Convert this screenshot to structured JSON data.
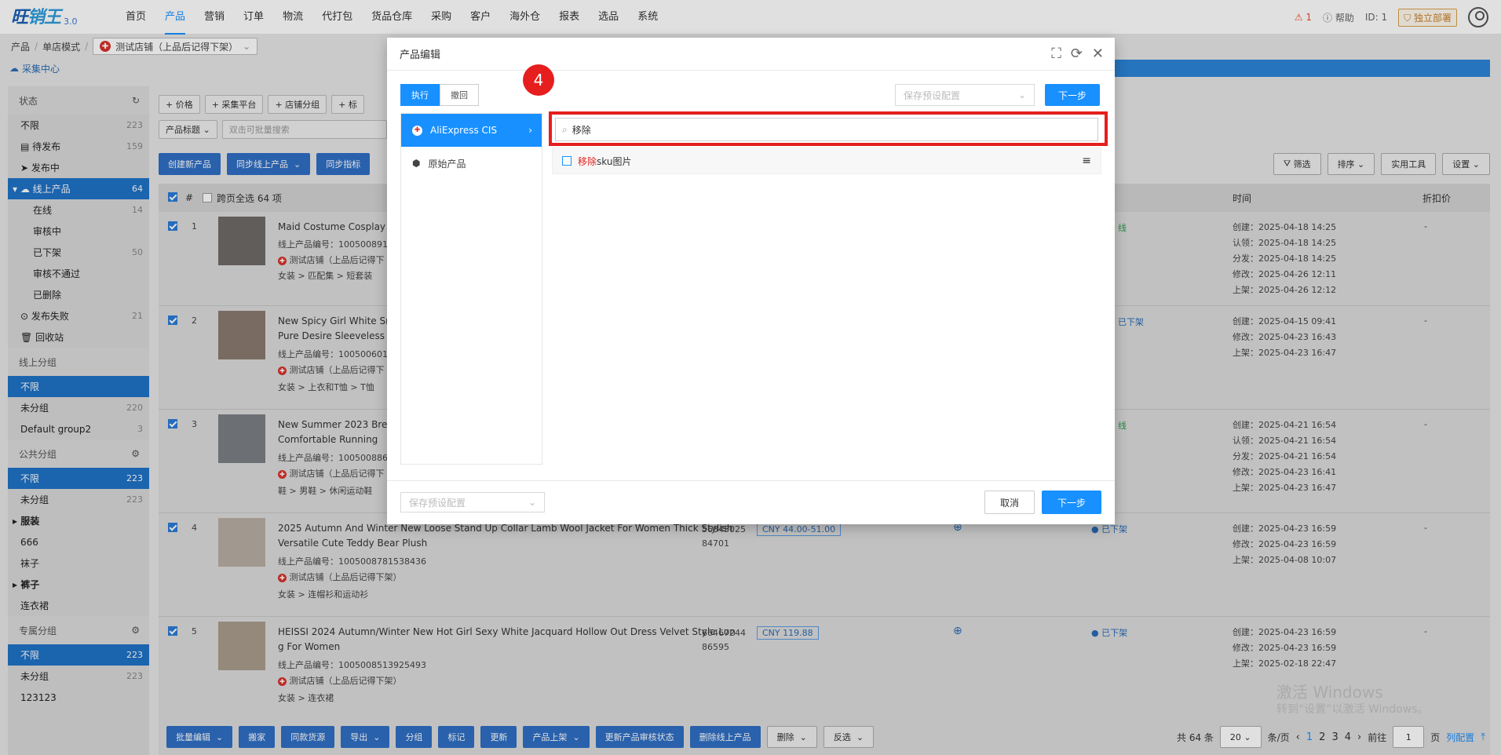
{
  "logo": {
    "text": "旺",
    "text2": "销王",
    "version": "3.0"
  },
  "nav": [
    "首页",
    "产品",
    "营销",
    "订单",
    "物流",
    "代打包",
    "货品仓库",
    "采购",
    "客户",
    "海外仓",
    "报表",
    "选品",
    "系统"
  ],
  "topright": {
    "alert": "⚠ 1",
    "help": "帮助",
    "id": "ID: 1",
    "deploy": "独立部署"
  },
  "breadcrumb": {
    "a": "产品",
    "b": "单店模式",
    "shop": "测试店铺（上品后记得下架）"
  },
  "cloud": "采集中心",
  "sidebar": {
    "status_head": "状态",
    "status": [
      {
        "l": "不限",
        "c": "223"
      },
      {
        "l": "待发布",
        "c": "159"
      },
      {
        "l": "发布中",
        "c": ""
      },
      {
        "l": "线上产品",
        "c": "64"
      },
      {
        "l": "在线",
        "c": "14"
      },
      {
        "l": "审核中",
        "c": ""
      },
      {
        "l": "已下架",
        "c": "50"
      },
      {
        "l": "审核不通过",
        "c": ""
      },
      {
        "l": "已删除",
        "c": ""
      },
      {
        "l": "发布失败",
        "c": "21"
      },
      {
        "l": "回收站",
        "c": ""
      }
    ],
    "online_head": "线上分组",
    "online": [
      {
        "l": "不限",
        "c": ""
      },
      {
        "l": "未分组",
        "c": "220"
      },
      {
        "l": "Default group2",
        "c": "3"
      }
    ],
    "public_head": "公共分组",
    "public": [
      {
        "l": "不限",
        "c": "223"
      },
      {
        "l": "未分组",
        "c": "223"
      },
      {
        "l": "服装",
        "c": ""
      },
      {
        "l": "666",
        "c": ""
      },
      {
        "l": "袜子",
        "c": ""
      },
      {
        "l": "裤子",
        "c": ""
      },
      {
        "l": "连衣裙",
        "c": ""
      }
    ],
    "exclusive_head": "专属分组",
    "exclusive": [
      {
        "l": "不限",
        "c": "223"
      },
      {
        "l": "未分组",
        "c": "223"
      },
      {
        "l": "123123",
        "c": ""
      }
    ]
  },
  "filters": [
    "+ 价格",
    "+ 采集平台",
    "+ 店铺分组",
    "+ 标"
  ],
  "search_field": {
    "sel": "产品标题",
    "ph": "双击可批量搜索"
  },
  "actions": [
    "创建新产品",
    "同步线上产品",
    "同步指标"
  ],
  "tools": [
    "筛选",
    "排序",
    "实用工具",
    "设置"
  ],
  "thead": {
    "num": "#",
    "all": "跨页全选 64 项",
    "time": "时间",
    "discount": "折扣价"
  },
  "rows": [
    {
      "n": "1",
      "title": "Maid Costume Cosplay Ap",
      "title2": "",
      "code": "线上产品编号：10050089112",
      "shop": "测试店铺（上品后记得下",
      "cat": "女装 > 匹配集 > 短套装",
      "status": "线",
      "times": [
        "创建：2025-04-18 14:25",
        "认领：2025-04-18 14:25",
        "分发：2025-04-18 14:25",
        "修改：2025-04-26 12:11",
        "上架：2025-04-26 12:12"
      ],
      "disc": "-"
    },
    {
      "n": "2",
      "title": "New Spicy Girl White Smal",
      "title2": "Pure Desire Sleeveless Bo",
      "code": "线上产品编号：10050060191",
      "shop": "测试店铺（上品后记得下",
      "cat": "女装 > 上衣和T恤 > T恤",
      "status": "已下架",
      "times": [
        "创建：2025-04-15 09:41",
        "修改：2025-04-23 16:43",
        "上架：2025-04-23 16:47"
      ],
      "disc": "-"
    },
    {
      "n": "3",
      "title": "New Summer 2023 Breath",
      "title2": "Comfortable Running",
      "code": "线上产品编号：10050088695",
      "shop": "测试店铺（上品后记得下",
      "cat": "鞋 > 男鞋 > 休闲运动鞋",
      "status": "线",
      "times": [
        "创建：2025-04-21 16:54",
        "认领：2025-04-21 16:54",
        "分发：2025-04-21 16:54",
        "修改：2025-04-23 16:41",
        "上架：2025-04-23 16:47"
      ],
      "disc": "-"
    },
    {
      "n": "4",
      "title": "2025 Autumn And Winter New Loose Stand Up Collar Lamb Wool Jacket For Women Thick Stylish",
      "title2": "Versatile Cute Teddy Bear Plush",
      "code": "线上产品编号：1005008781538436",
      "shop": "测试店铺（上品后记得下架）",
      "cat": "女装 > 连帽衫和运动衫",
      "sku": "56845025",
      "sku2": "84701",
      "price": "CNY  44.00-51.00",
      "status": "已下架",
      "times": [
        "创建：2025-04-23 16:59",
        "修改：2025-04-23 16:59",
        "上架：2025-04-08 10:07"
      ],
      "disc": "-"
    },
    {
      "n": "5",
      "title": "HEISSI 2024 Autumn/Winter New Hot Girl Sexy White Jacquard Hollow Out Dress Velvet Style Lon",
      "title2": "g For Women",
      "code": "线上产品编号：1005008513925493",
      "shop": "测试店铺（上品后记得下架）",
      "cat": "女装 > 连衣裙",
      "sku": "66467244",
      "sku2": "86595",
      "price": "CNY  119.88",
      "status": "已下架",
      "times": [
        "创建：2025-04-23 16:59",
        "修改：2025-04-23 16:59",
        "上架：2025-02-18 22:47"
      ],
      "disc": "-"
    }
  ],
  "bottom": [
    "批量编辑",
    "搬家",
    "同款货源",
    "导出",
    "分组",
    "标记",
    "更新",
    "产品上架",
    "更新产品审核状态",
    "删除线上产品",
    "删除",
    "反选"
  ],
  "pager": {
    "total": "共 64 条",
    "size": "20",
    "per": "条/页",
    "pages": [
      "1",
      "2",
      "3",
      "4"
    ],
    "goto": "前往",
    "page": "1",
    "unit": "页",
    "cols": "列配置"
  },
  "modal": {
    "title": "产品编辑",
    "tab_exec": "执行",
    "tab_undo": "撤回",
    "preset_top": "保存预设配置",
    "next_top": "下一步",
    "platform": "AliExpress CIS",
    "origin": "原始产品",
    "search_value": "移除",
    "option_hl": "移除",
    "option_rest": "sku图片",
    "preset_bottom": "保存预设配置",
    "cancel": "取消",
    "next_bottom": "下一步",
    "step": "4"
  },
  "watermark": {
    "l1": "激活 Windows",
    "l2": "转到“设置”以激活 Windows。"
  }
}
